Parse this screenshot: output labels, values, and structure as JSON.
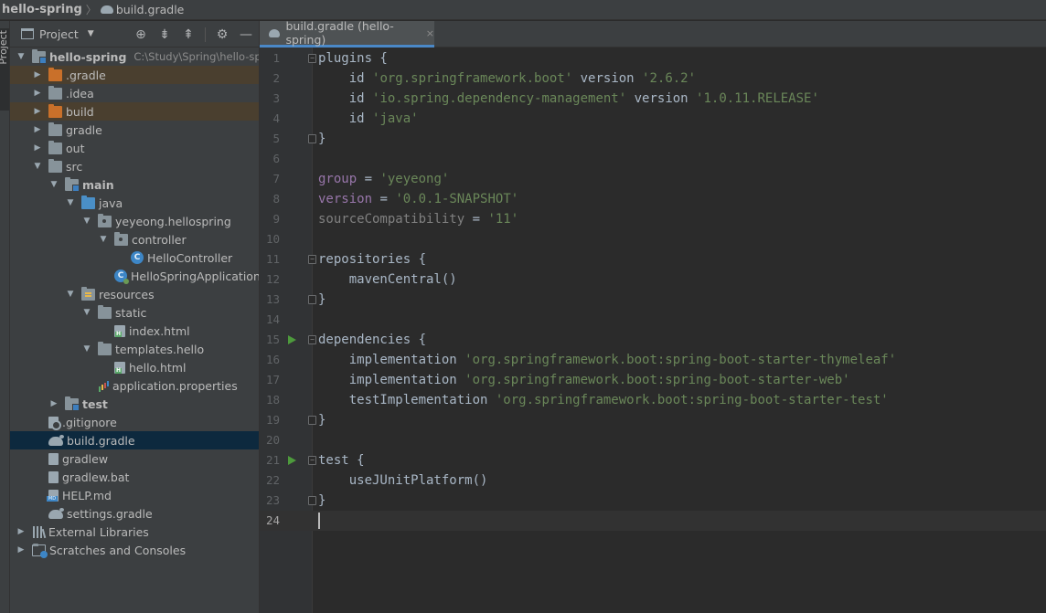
{
  "navbar": {
    "project": "hello-spring",
    "separator": "〉",
    "file": "build.gradle"
  },
  "stripe": {
    "project_tab": "Project"
  },
  "panel": {
    "title": "Project",
    "tools": [
      "locate-icon",
      "expand-all-icon",
      "collapse-all-icon",
      "gear-icon",
      "minimize-icon"
    ]
  },
  "tree": [
    {
      "label": "hello-spring",
      "path": "C:\\Study\\Spring\\hello-spring",
      "depth": 0,
      "arrow": "down",
      "icon": "module-folder",
      "bold": true,
      "state": ""
    },
    {
      "label": ".gradle",
      "depth": 1,
      "arrow": "right",
      "icon": "excluded-folder",
      "state": "excluded"
    },
    {
      "label": ".idea",
      "depth": 1,
      "arrow": "right",
      "icon": "folder",
      "state": ""
    },
    {
      "label": "build",
      "depth": 1,
      "arrow": "right",
      "icon": "excluded-folder",
      "state": "excluded"
    },
    {
      "label": "gradle",
      "depth": 1,
      "arrow": "right",
      "icon": "folder",
      "state": ""
    },
    {
      "label": "out",
      "depth": 1,
      "arrow": "right",
      "icon": "folder",
      "state": ""
    },
    {
      "label": "src",
      "depth": 1,
      "arrow": "down",
      "icon": "folder",
      "state": ""
    },
    {
      "label": "main",
      "depth": 2,
      "arrow": "down",
      "icon": "module-folder",
      "bold": true,
      "state": ""
    },
    {
      "label": "java",
      "depth": 3,
      "arrow": "down",
      "icon": "source-folder",
      "state": ""
    },
    {
      "label": "yeyeong.hellospring",
      "depth": 4,
      "arrow": "down",
      "icon": "package",
      "state": ""
    },
    {
      "label": "controller",
      "depth": 5,
      "arrow": "down",
      "icon": "package",
      "state": ""
    },
    {
      "label": "HelloController",
      "depth": 6,
      "arrow": "none",
      "icon": "class",
      "state": ""
    },
    {
      "label": "HelloSpringApplication",
      "depth": 5,
      "arrow": "none",
      "icon": "spring-class",
      "state": ""
    },
    {
      "label": "resources",
      "depth": 3,
      "arrow": "down",
      "icon": "resources-folder",
      "state": ""
    },
    {
      "label": "static",
      "depth": 4,
      "arrow": "down",
      "icon": "folder",
      "state": ""
    },
    {
      "label": "index.html",
      "depth": 5,
      "arrow": "none",
      "icon": "html-file",
      "state": ""
    },
    {
      "label": "templates.hello",
      "depth": 4,
      "arrow": "down",
      "icon": "folder",
      "state": ""
    },
    {
      "label": "hello.html",
      "depth": 5,
      "arrow": "none",
      "icon": "html-file",
      "state": ""
    },
    {
      "label": "application.properties",
      "depth": 4,
      "arrow": "none",
      "icon": "properties-file",
      "state": ""
    },
    {
      "label": "test",
      "depth": 2,
      "arrow": "right",
      "icon": "module-folder",
      "bold": true,
      "state": ""
    },
    {
      "label": ".gitignore",
      "depth": 1,
      "arrow": "none",
      "icon": "gitignore-file",
      "state": ""
    },
    {
      "label": "build.gradle",
      "depth": 1,
      "arrow": "none",
      "icon": "gradle-file",
      "state": "selected"
    },
    {
      "label": "gradlew",
      "depth": 1,
      "arrow": "none",
      "icon": "file",
      "state": ""
    },
    {
      "label": "gradlew.bat",
      "depth": 1,
      "arrow": "none",
      "icon": "file",
      "state": ""
    },
    {
      "label": "HELP.md",
      "depth": 1,
      "arrow": "none",
      "icon": "markdown-file",
      "state": ""
    },
    {
      "label": "settings.gradle",
      "depth": 1,
      "arrow": "none",
      "icon": "gradle-file",
      "state": ""
    },
    {
      "label": "External Libraries",
      "depth": 0,
      "arrow": "right",
      "icon": "libraries",
      "state": ""
    },
    {
      "label": "Scratches and Consoles",
      "depth": 0,
      "arrow": "right",
      "icon": "scratches",
      "state": ""
    }
  ],
  "editor": {
    "tab_label": "build.gradle (hello-spring)",
    "tab_close": "×",
    "current_line": 24,
    "lines": [
      {
        "n": "1",
        "fold": "open",
        "tokens": [
          [
            "plugins {",
            ""
          ]
        ]
      },
      {
        "n": "2",
        "tokens": [
          [
            "    id ",
            ""
          ],
          [
            "'org.springframework.boot'",
            "str"
          ],
          [
            " version ",
            ""
          ],
          [
            "'2.6.2'",
            "str"
          ]
        ]
      },
      {
        "n": "3",
        "tokens": [
          [
            "    id ",
            ""
          ],
          [
            "'io.spring.dependency-management'",
            "str"
          ],
          [
            " version ",
            ""
          ],
          [
            "'1.0.11.RELEASE'",
            "str"
          ]
        ]
      },
      {
        "n": "4",
        "tokens": [
          [
            "    id ",
            ""
          ],
          [
            "'java'",
            "str"
          ]
        ]
      },
      {
        "n": "5",
        "fold": "close",
        "tokens": [
          [
            "}",
            ""
          ]
        ]
      },
      {
        "n": "6",
        "tokens": []
      },
      {
        "n": "7",
        "tokens": [
          [
            "group",
            "prop"
          ],
          [
            " = ",
            ""
          ],
          [
            "'yeyeong'",
            "str"
          ]
        ]
      },
      {
        "n": "8",
        "tokens": [
          [
            "version",
            "prop"
          ],
          [
            " = ",
            ""
          ],
          [
            "'0.0.1-SNAPSHOT'",
            "str"
          ]
        ]
      },
      {
        "n": "9",
        "tokens": [
          [
            "sourceCompatibility",
            "dim"
          ],
          [
            " = ",
            ""
          ],
          [
            "'11'",
            "str"
          ]
        ]
      },
      {
        "n": "10",
        "tokens": []
      },
      {
        "n": "11",
        "fold": "open",
        "tokens": [
          [
            "repositories {",
            ""
          ]
        ]
      },
      {
        "n": "12",
        "tokens": [
          [
            "    mavenCentral()",
            ""
          ]
        ]
      },
      {
        "n": "13",
        "fold": "close",
        "tokens": [
          [
            "}",
            ""
          ]
        ]
      },
      {
        "n": "14",
        "tokens": []
      },
      {
        "n": "15",
        "fold": "open",
        "run": true,
        "tokens": [
          [
            "dependencies {",
            ""
          ]
        ]
      },
      {
        "n": "16",
        "tokens": [
          [
            "    implementation ",
            ""
          ],
          [
            "'org.springframework.boot:spring-boot-starter-thymeleaf'",
            "str"
          ]
        ]
      },
      {
        "n": "17",
        "tokens": [
          [
            "    implementation ",
            ""
          ],
          [
            "'org.springframework.boot:spring-boot-starter-web'",
            "str"
          ]
        ]
      },
      {
        "n": "18",
        "tokens": [
          [
            "    testImplementation ",
            ""
          ],
          [
            "'org.springframework.boot:spring-boot-starter-test'",
            "str"
          ]
        ]
      },
      {
        "n": "19",
        "fold": "close",
        "tokens": [
          [
            "}",
            ""
          ]
        ]
      },
      {
        "n": "20",
        "tokens": []
      },
      {
        "n": "21",
        "fold": "open",
        "run": true,
        "tokens": [
          [
            "test {",
            ""
          ]
        ]
      },
      {
        "n": "22",
        "tokens": [
          [
            "    useJUnitPlatform()",
            ""
          ]
        ]
      },
      {
        "n": "23",
        "fold": "close",
        "tokens": [
          [
            "}",
            ""
          ]
        ]
      },
      {
        "n": "24",
        "tokens": []
      }
    ]
  }
}
